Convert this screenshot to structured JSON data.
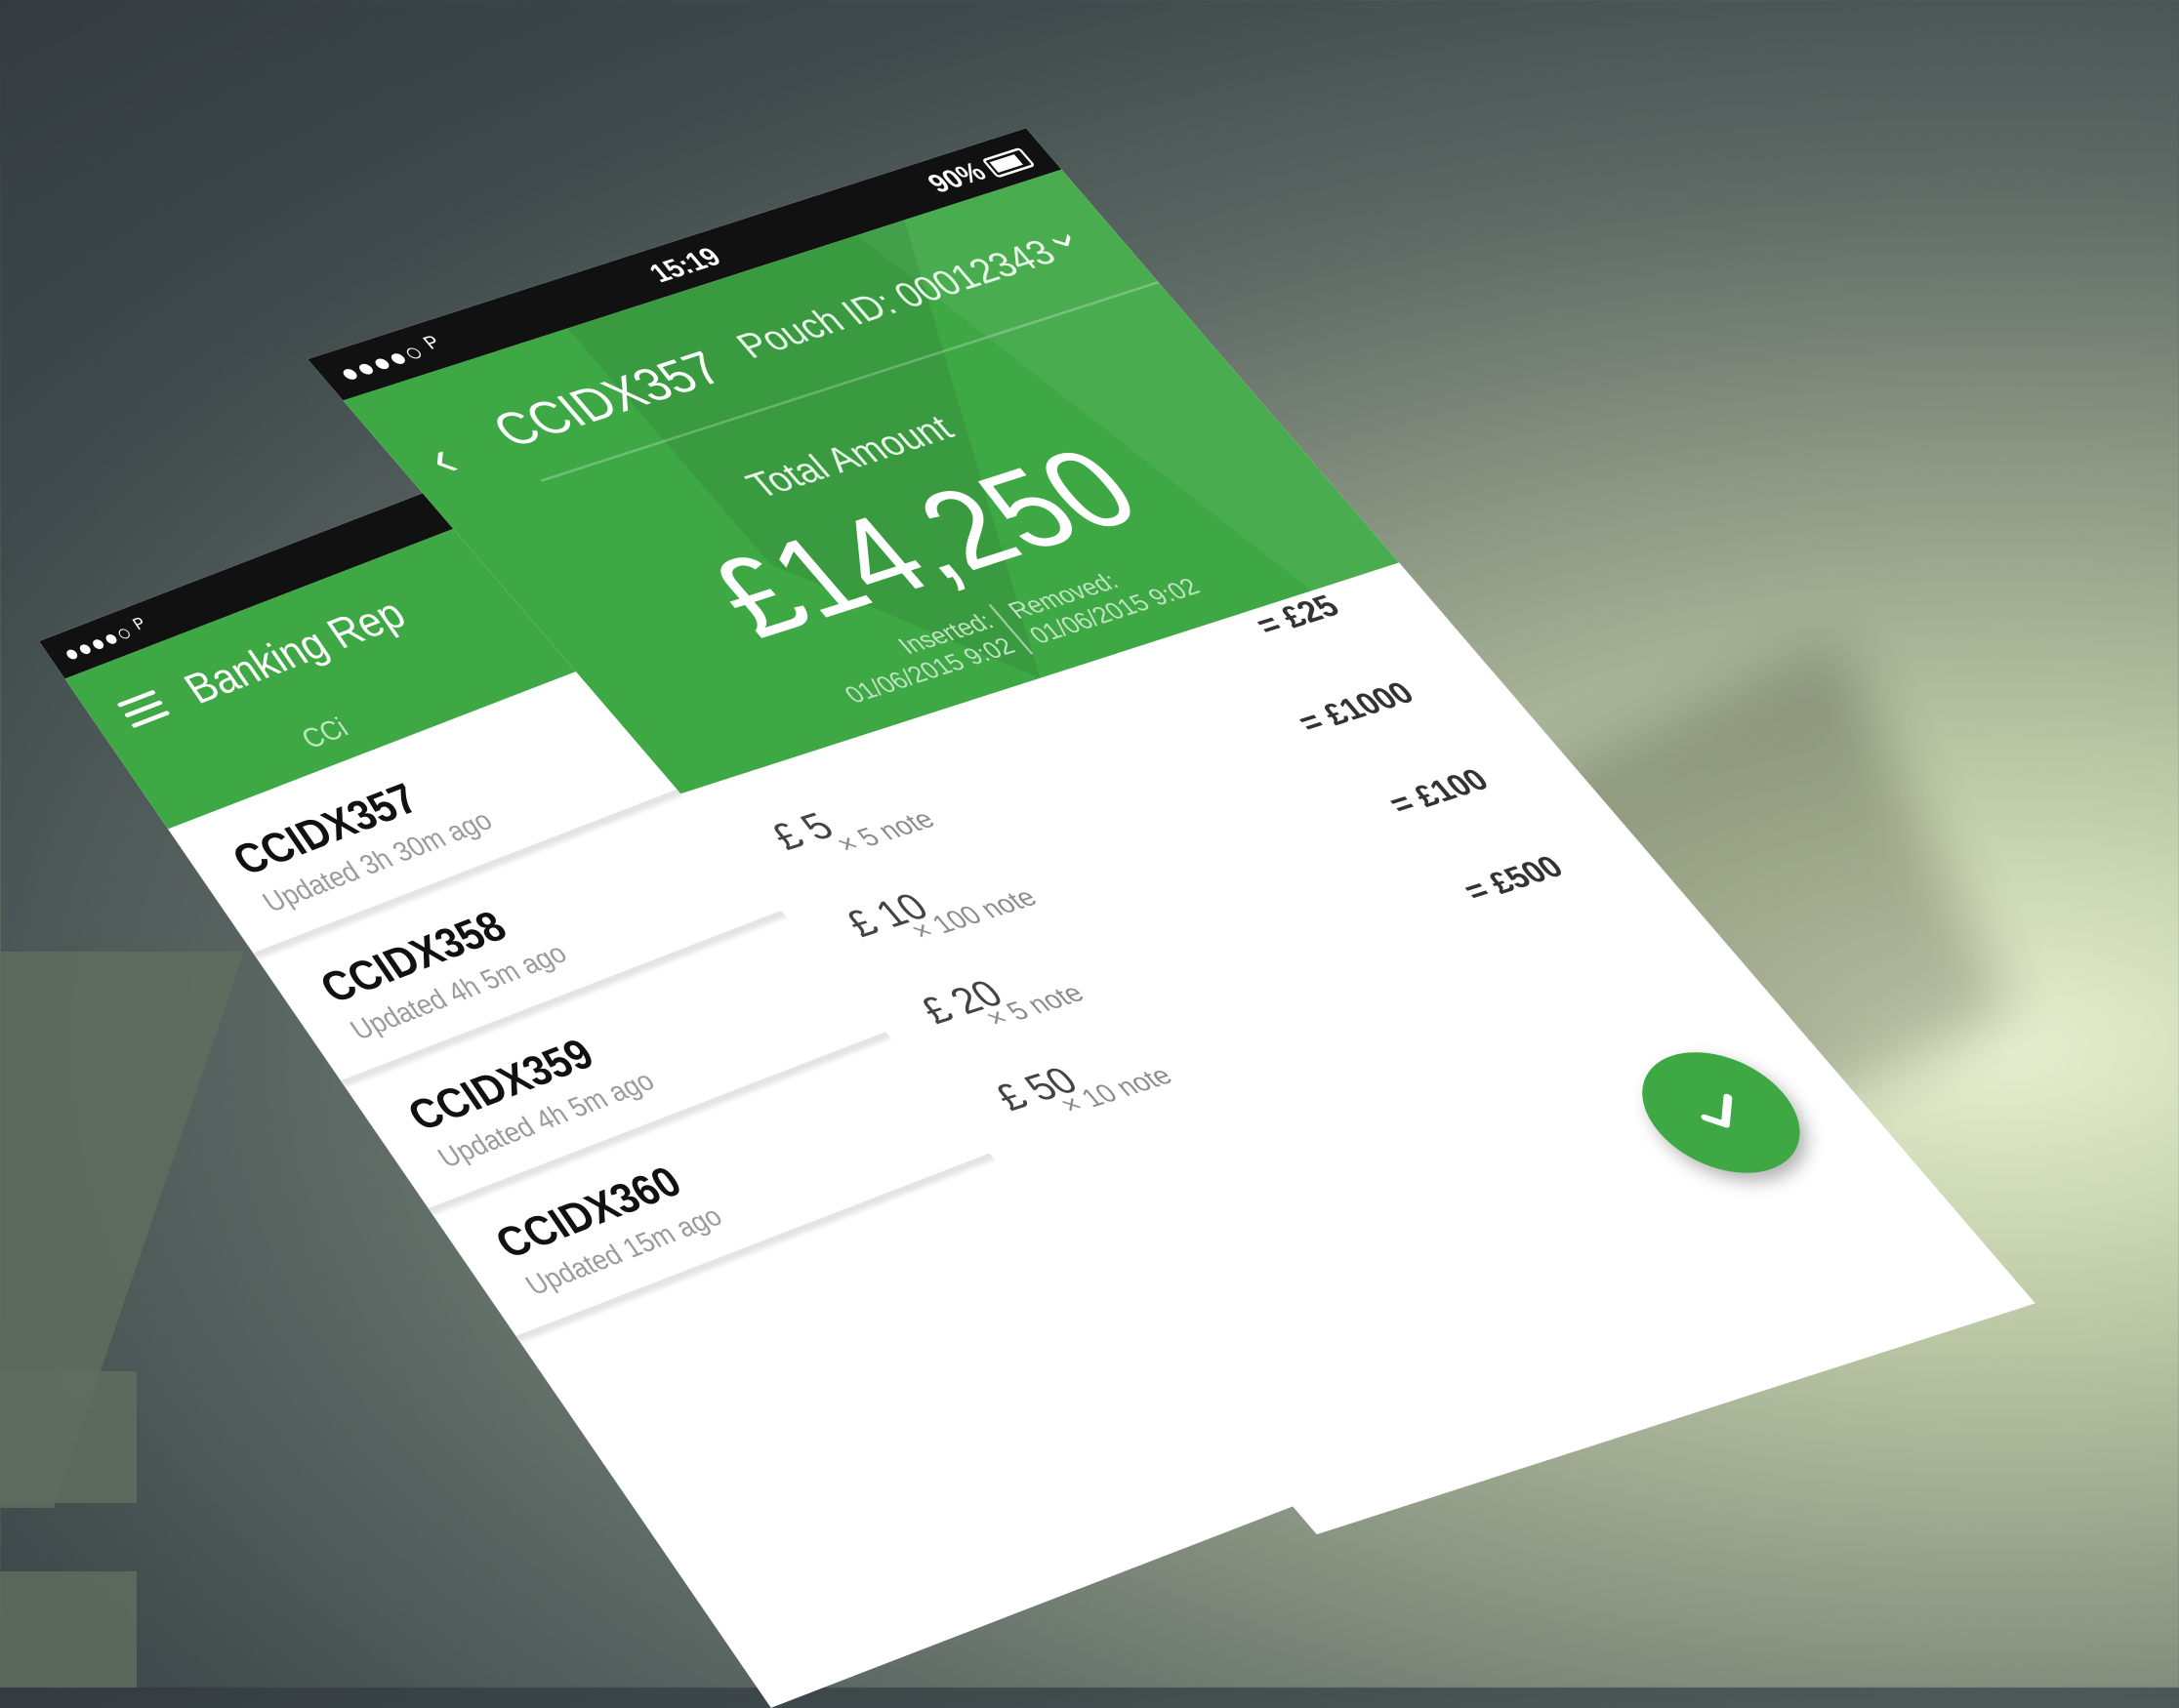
{
  "back_screen": {
    "status": {
      "signal": "●●●●○ ᴾ"
    },
    "title": "Banking Rep",
    "tab": "CCi",
    "rows": [
      {
        "id": "CCIDX357",
        "updated": "Updated 3h 30m ago"
      },
      {
        "id": "CCIDX358",
        "updated": "Updated 4h 5m ago"
      },
      {
        "id": "CCIDX359",
        "updated": "Updated 4h 5m ago"
      },
      {
        "id": "CCIDX360",
        "updated": "Updated 15m ago"
      }
    ]
  },
  "front_screen": {
    "status": {
      "signal": "●●●●○ ᴾ",
      "time": "15:19",
      "battery": "90%"
    },
    "back_symbol": "‹",
    "title": "CCIDX357",
    "pouch_id": "Pouch ID: 00012343",
    "chevron_symbol": "‹",
    "total_label": "Total Amount",
    "total_amount": "£14,250",
    "inserted_label": "Inserted:",
    "inserted_value": "01/06/2015  9:02",
    "removed_label": "Removed:",
    "removed_value": "01/06/2015  9:02",
    "notes": [
      {
        "value": "£ 5",
        "qty": "× 5 note",
        "total": "= £25"
      },
      {
        "value": "£ 10",
        "qty": "× 100 note",
        "total": "= £1000"
      },
      {
        "value": "£ 20",
        "qty": "× 5 note",
        "total": "= £100"
      },
      {
        "value": "£ 50",
        "qty": "× 10 note",
        "total": "= £500"
      }
    ]
  },
  "colors": {
    "accent": "#3ea845",
    "background_light": "#e6efcf",
    "background_dark": "#333b40"
  },
  "icons": {
    "menu": "menu-icon",
    "back": "back-arrow-icon",
    "fab": "check-icon",
    "chevron": "chevron-icon",
    "battery": "battery-icon"
  }
}
